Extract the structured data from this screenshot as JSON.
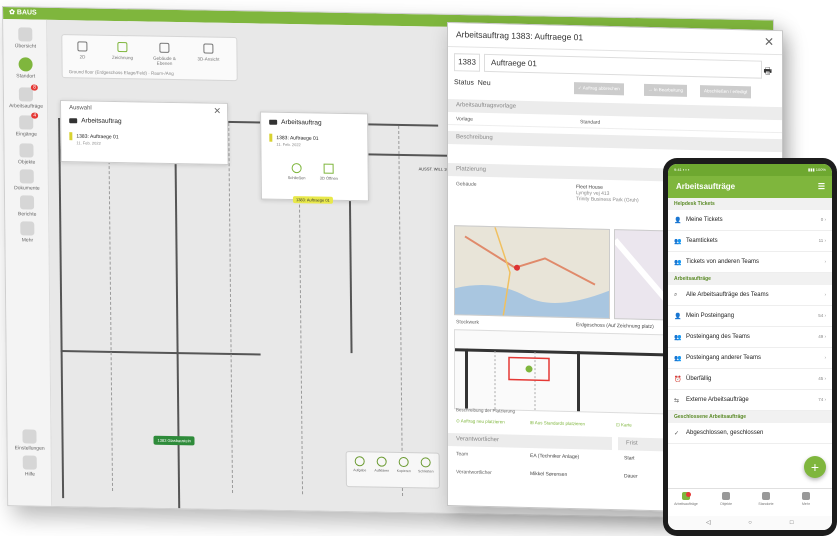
{
  "app": {
    "logo_text": "✿ BAUS"
  },
  "sidebar": {
    "items": [
      {
        "label": "Übersicht",
        "badge": ""
      },
      {
        "label": "Standort",
        "badge": ""
      },
      {
        "label": "Arbeitsaufträge",
        "badge": "8"
      },
      {
        "label": "Eingänge",
        "badge": "4"
      },
      {
        "label": "Objekte",
        "badge": ""
      },
      {
        "label": "Dokumente",
        "badge": ""
      },
      {
        "label": "Berichte",
        "badge": ""
      },
      {
        "label": "Mehr",
        "badge": ""
      }
    ],
    "bottom_items": [
      {
        "label": "Einstellungen"
      },
      {
        "label": "Hilfe"
      }
    ]
  },
  "plan_toolbar": {
    "tools": [
      "2D",
      "Zeichnung",
      "Gebäude & Ebenen",
      "3D-Ansicht"
    ],
    "footer": "Ground floor (Erdgeschoss Etage/Feld) · Raum-/Ang"
  },
  "left_panel": {
    "title": "Auswahl",
    "header": "Arbeitsauftrag",
    "item_title": "1383: Auftraege 01",
    "item_sub": "11. Feb. 2022"
  },
  "popup": {
    "header": "Arbeitsauftrag",
    "item_title": "1383: Auftraege 01",
    "item_sub": "11. Feb. 2022",
    "action1": "Schließen",
    "action2": "3D Öffnen",
    "tag": "1383: Auftraege 01"
  },
  "plan_labels": {
    "room_label": "AUSST. WILL 1000",
    "green_tag": "1383 Glasbaustein"
  },
  "bottom_toolbar": [
    "Aufgabe",
    "Aufklären",
    "Kopieren",
    "Schließen"
  ],
  "order": {
    "title": "Arbeitsauftrag 1383: Auftraege 01",
    "number": "1383",
    "name": "Auftraege 01",
    "status_label": "Status",
    "status_value": "Neu",
    "status_buttons": [
      "✓ Auftrag abbrechen",
      "→ In Bearbeitung",
      "Abschließen / erledigt"
    ],
    "template_section": "Arbeitsauftragsvorlage",
    "template_label": "Vorlage",
    "template_value": "Standard",
    "description_section": "Beschreibung",
    "planning_section": "Platzierung",
    "location_label": "Gebäude",
    "location_lines": [
      "Fleet House",
      "Lyngby vej 413",
      "Trinity Business Park (Gruh)"
    ],
    "floor_label": "Stockwerk",
    "floor_value": "Erdgeschoss (Auf Zeichnung platz)",
    "placement_desc": "Beschreibung der Platzierung",
    "links": [
      "⊙ Auftrag neu platzieren",
      "⊞ Aus Standards platzieren",
      "⊡ Karte"
    ],
    "resp_section": "Verantwortlicher",
    "team_label": "Team",
    "team_value": "EA (Techniker Anlage)",
    "resp_label": "Verantwortlicher",
    "resp_value": "Mikkel Sørensen",
    "due_section": "Frist",
    "start_label": "Start",
    "end_label": "Dauer"
  },
  "phone": {
    "status_left": "9:41 ▪ ▪ ▪",
    "status_right": "▮▮▮ 100%",
    "title": "Arbeitsaufträge",
    "sections": [
      {
        "header": "Helpdesk Tickets",
        "items": [
          {
            "icon": "user-icon",
            "label": "Meine Tickets",
            "count": "0 ›"
          },
          {
            "icon": "users-icon",
            "label": "Teamtickets",
            "count": "11 ›"
          },
          {
            "icon": "users-icon",
            "label": "Tickets von anderen Teams",
            "count": "›"
          }
        ]
      },
      {
        "header": "Arbeitsaufträge",
        "items": [
          {
            "icon": "search-icon",
            "label": "Alle Arbeitsaufträge des Teams",
            "count": "›"
          },
          {
            "icon": "user-icon",
            "label": "Mein Posteingang",
            "count": "54 ›"
          },
          {
            "icon": "users-icon",
            "label": "Posteingang des Teams",
            "count": "49 ›"
          },
          {
            "icon": "users-icon",
            "label": "Posteingang anderer Teams",
            "count": "›"
          },
          {
            "icon": "overdue-icon",
            "label": "Überfällig",
            "count": "45 ›"
          },
          {
            "icon": "external-icon",
            "label": "Externe Arbeitsaufträge",
            "count": "74 ›"
          }
        ]
      },
      {
        "header": "Geschlossene Arbeitsaufträge",
        "items": [
          {
            "icon": "check-icon",
            "label": "Abgeschlossen, geschlossen",
            "count": ""
          }
        ]
      }
    ],
    "nav": [
      "Arbeitsaufträge",
      "Objekte",
      "Standorte",
      "Mehr"
    ],
    "fab": "+",
    "sys": [
      "◁",
      "○",
      "□"
    ],
    "accent": "#7fb63d"
  }
}
